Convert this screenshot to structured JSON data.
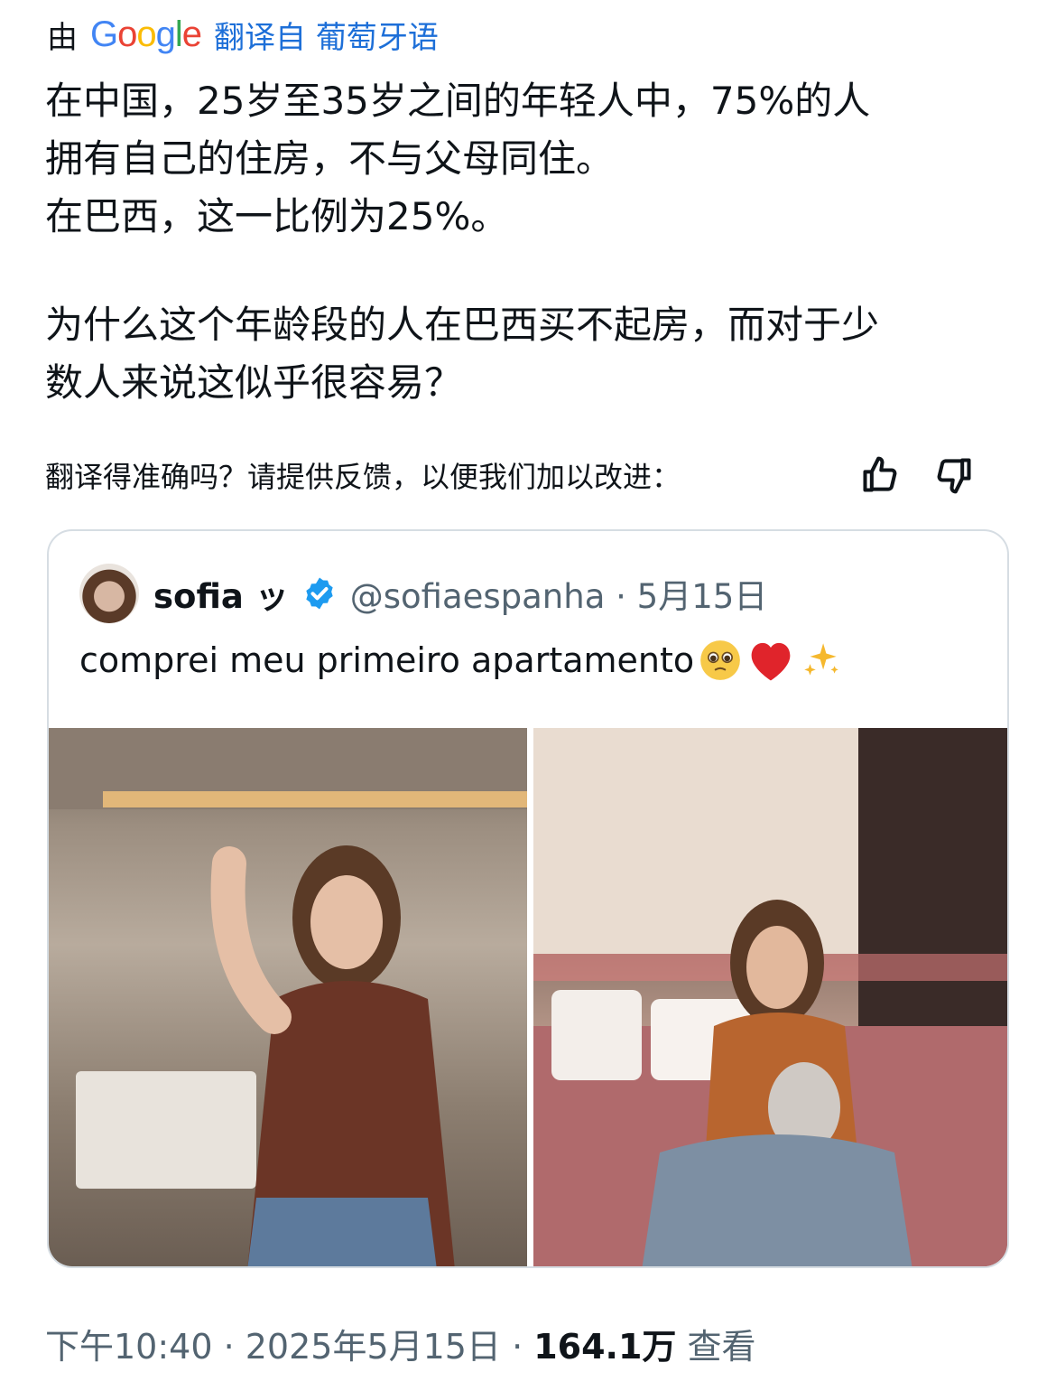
{
  "translation_bar": {
    "prefix": "由",
    "brand": [
      "G",
      "o",
      "o",
      "g",
      "l",
      "e"
    ],
    "link": "翻译自 葡萄牙语"
  },
  "translated_text": {
    "line1": "在中国，25岁至35岁之间的年轻人中，75%的人",
    "line2": "拥有自己的住房，不与父母同住。",
    "line3": "在巴西，这一比例为25%。",
    "line4": "为什么这个年龄段的人在巴西买不起房，而对于少",
    "line5": "数人来说这似乎很容易？"
  },
  "feedback": {
    "label": "翻译得准确吗？请提供反馈，以便我们加以改进：",
    "thumbs_up_icon": "thumbs-up-icon",
    "thumbs_down_icon": "thumbs-down-icon"
  },
  "quote": {
    "author_name": "sofia ッ",
    "handle_date": "@sofiaespanha · 5月15日",
    "text": "comprei meu primeiro apartamento",
    "emojis": [
      "pleading-face-icon",
      "red-heart-icon",
      "sparkles-icon"
    ],
    "verified_color": "#1d9bf0"
  },
  "footer": {
    "time_date": "下午10:40 · 2025年5月15日 · ",
    "views_count": "164.1万",
    "views_label": "查看"
  },
  "colors": {
    "link_blue": "#1d6fd8",
    "muted": "#536471"
  }
}
